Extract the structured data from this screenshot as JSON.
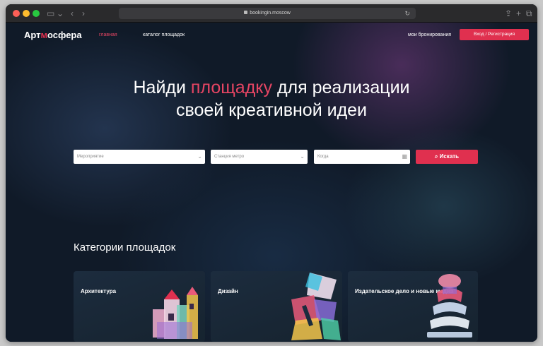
{
  "browser": {
    "url": "bookingin.moscow"
  },
  "nav": {
    "logo_prefix": "Арт",
    "logo_mark": "м",
    "logo_suffix": "осфера",
    "links": [
      "главная",
      "каталог площадок"
    ],
    "bookings": "мои бронирования",
    "login": "Вход / Регистрация"
  },
  "hero": {
    "line1_before": "Найди ",
    "line1_accent": "площадку",
    "line1_after": " для реализации",
    "line2": "своей креативной идеи"
  },
  "search": {
    "event_placeholder": "Мероприятие",
    "metro_placeholder": "Станция метро",
    "date_placeholder": "Когда",
    "button": "Искать"
  },
  "categories": {
    "heading": "Категории площадок",
    "items": [
      {
        "label": "Архитектура"
      },
      {
        "label": "Дизайн"
      },
      {
        "label": "Издательское дело и новые медиа"
      }
    ]
  },
  "colors": {
    "accent": "#e0304f",
    "background": "#101a28"
  }
}
